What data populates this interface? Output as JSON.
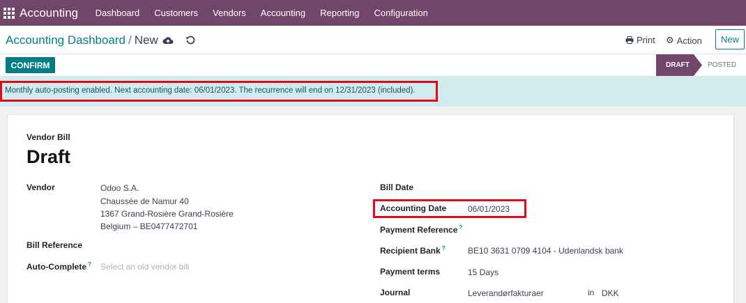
{
  "navbar": {
    "brand": "Accounting",
    "items": [
      "Dashboard",
      "Customers",
      "Vendors",
      "Accounting",
      "Reporting",
      "Configuration"
    ]
  },
  "control": {
    "breadcrumb_parent": "Accounting Dashboard",
    "breadcrumb_separator": "/",
    "breadcrumb_current": "New",
    "print_label": "Print",
    "action_label": "Action",
    "new_label": "New"
  },
  "statusbar": {
    "confirm_label": "CONFIRM",
    "stages": [
      "DRAFT",
      "POSTED"
    ],
    "active_stage": "DRAFT"
  },
  "banner": {
    "text": "Monthly auto-posting enabled. Next accounting date: 06/01/2023. The recurrence will end on 12/31/2023 (included)."
  },
  "form": {
    "doc_type": "Vendor Bill",
    "title": "Draft",
    "vendor_label": "Vendor",
    "vendor_lines": [
      "Odoo S.A.",
      "Chaussée de Namur 40",
      "1367 Grand-Rosière Grand-Rosière",
      "Belgium – BE0477472701"
    ],
    "bill_reference_label": "Bill Reference",
    "auto_complete_label": "Auto-Complete",
    "auto_complete_tip": "?",
    "auto_complete_placeholder": "Select an old vendor bill",
    "bill_date_label": "Bill Date",
    "accounting_date_label": "Accounting Date",
    "accounting_date_value": "06/01/2023",
    "payment_reference_label": "Payment Reference",
    "payment_reference_tip": "?",
    "recipient_bank_label": "Recipient Bank",
    "recipient_bank_tip": "?",
    "recipient_bank_value": "BE10 3631 0709 4104 - Udenlandsk bank",
    "payment_terms_label": "Payment terms",
    "payment_terms_value": "15 Days",
    "journal_label": "Journal",
    "journal_value": "Leverandørfakturaer",
    "journal_in": "in",
    "journal_currency": "DKK"
  },
  "colors": {
    "navbar": "#71466a",
    "primary": "#017e84",
    "banner": "#d2ebee",
    "highlight": "#e00d16"
  },
  "icons": [
    "apps-grid-icon",
    "cloud-upload-icon",
    "undo-icon",
    "print-icon",
    "gear-icon"
  ]
}
